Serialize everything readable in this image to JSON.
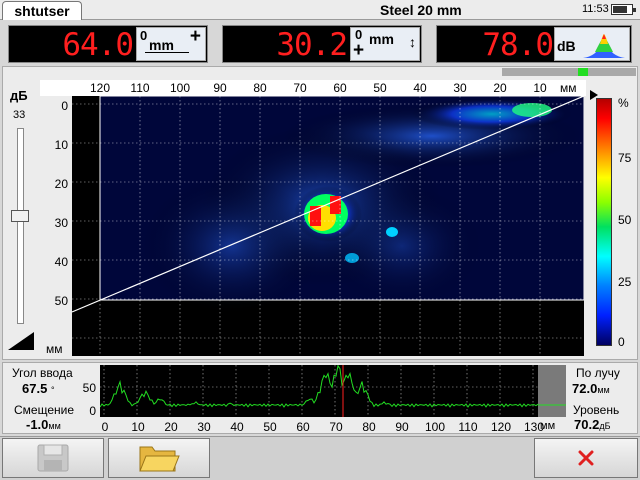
{
  "header": {
    "tab_label": "shtutser",
    "title": "Steel 20 mm",
    "time": "11:53"
  },
  "readouts": [
    {
      "value": "64.0",
      "unit": "mm"
    },
    {
      "value": "30.2",
      "unit": "mm"
    },
    {
      "value": "78.0",
      "unit": "dB"
    }
  ],
  "readout_signs": {
    "zero": "0",
    "plus": "+",
    "arrow": "↕"
  },
  "gain": {
    "label": "дБ",
    "value": "33",
    "level": 0.55
  },
  "bscan": {
    "x_ticks": [
      "120",
      "110",
      "100",
      "90",
      "80",
      "70",
      "60",
      "50",
      "40",
      "30",
      "20",
      "10"
    ],
    "x_unit": "мм",
    "y_ticks": [
      "0",
      "10",
      "20",
      "30",
      "40",
      "50"
    ],
    "y_unit": "мм",
    "scale_ticks": [
      "%",
      "75",
      "50",
      "25",
      "0"
    ],
    "scan_progress": 0.82
  },
  "ascan": {
    "y_ticks": [
      "50",
      "0"
    ],
    "x_ticks": [
      "0",
      "10",
      "20",
      "30",
      "40",
      "50",
      "60",
      "70",
      "80",
      "90",
      "100",
      "110",
      "120",
      "130"
    ],
    "x_unit": "мм",
    "angle_label": "Угол ввода",
    "angle_value": "67.5",
    "angle_unit": "°",
    "offset_label": "Смещение",
    "offset_value": "-1.0",
    "offset_unit": "мм",
    "beam_label": "По лучу",
    "beam_value": "72.0",
    "beam_unit": "мм",
    "level_label": "Уровень",
    "level_value": "70.2",
    "level_unit": "дБ"
  },
  "buttons": {
    "save_icon": "floppy-disk-icon",
    "open_icon": "folder-icon",
    "close_icon": "close-icon"
  },
  "colors": {
    "readout_text": "#ff1f1f",
    "trace": "#22dd22",
    "gate": "#ff2020",
    "close": "#e02020"
  }
}
